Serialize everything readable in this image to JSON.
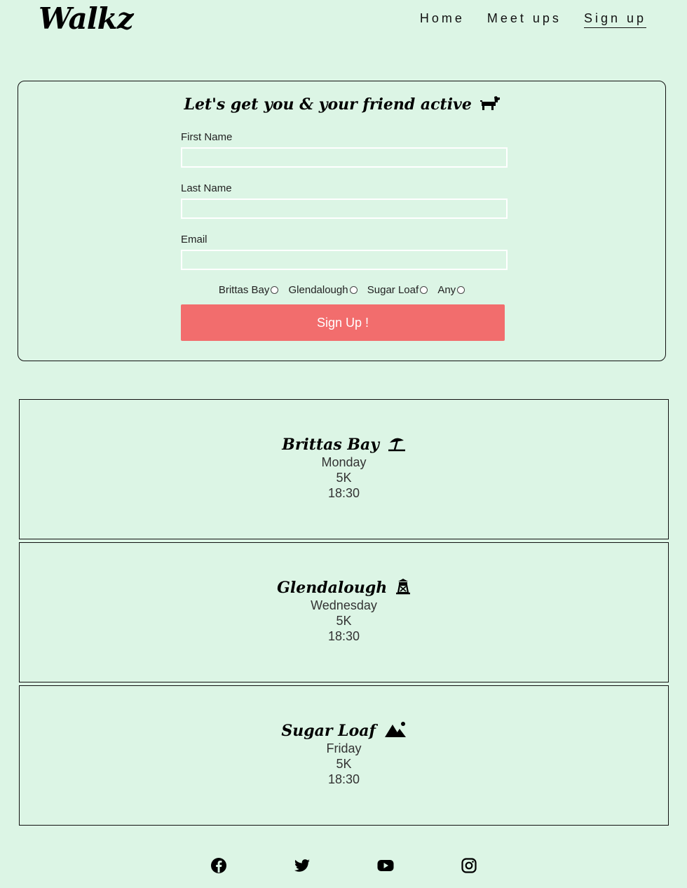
{
  "header": {
    "logo": "Walkz",
    "nav": [
      {
        "label": "Home"
      },
      {
        "label": "Meet ups"
      },
      {
        "label": "Sign up"
      }
    ]
  },
  "form": {
    "title": "Let's get you & your friend active",
    "title_icon": "dog-icon",
    "fields": [
      {
        "label": "First Name",
        "value": "",
        "placeholder": ""
      },
      {
        "label": "Last Name",
        "value": "",
        "placeholder": ""
      },
      {
        "label": "Email",
        "value": "",
        "placeholder": ""
      }
    ],
    "options": [
      "Brittas Bay",
      "Glendalough",
      "Sugar Loaf",
      "Any"
    ],
    "submit_label": "Sign Up !",
    "submit_color": "#f26d6d"
  },
  "walks": [
    {
      "name": "Brittas Bay",
      "icon": "beach-umbrella-icon",
      "day": "Monday",
      "distance": "5K",
      "time": "18:30"
    },
    {
      "name": "Glendalough",
      "icon": "tower-icon",
      "day": "Wednesday",
      "distance": "5K",
      "time": "18:30"
    },
    {
      "name": "Sugar Loaf",
      "icon": "mountain-icon",
      "day": "Friday",
      "distance": "5K",
      "time": "18:30"
    }
  ],
  "social": [
    "facebook-icon",
    "twitter-icon",
    "youtube-icon",
    "instagram-icon"
  ],
  "colors": {
    "background": "#dcf5e5",
    "button": "#f26d6d"
  }
}
